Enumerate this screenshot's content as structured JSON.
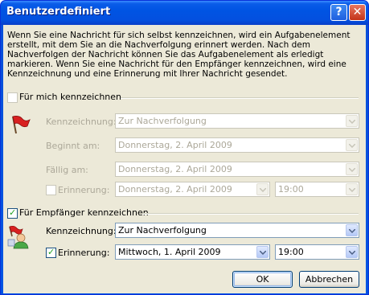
{
  "window": {
    "title": "Benutzerdefiniert",
    "help_glyph": "?",
    "close_glyph": "✕"
  },
  "intro_text": "Wenn Sie eine Nachricht für sich selbst kennzeichnen, wird ein Aufgabenelement erstellt, mit dem Sie an die Nachverfolgung erinnert werden. Nach dem Nachverfolgen der Nachricht können Sie das Aufgabenelement als erledigt markieren. Wenn Sie eine Nachricht für den Empfänger kennzeichnen, wird eine Kennzeichnung und eine Erinnerung mit Ihrer Nachricht gesendet.",
  "self_section": {
    "checkbox_label": "Für mich kennzeichnen",
    "checked": false,
    "flag_label": "Kennzeichnung:",
    "flag_value": "Zur Nachverfolgung",
    "start_label": "Beginnt am:",
    "start_value": "Donnerstag, 2. April 2009",
    "due_label": "Fällig am:",
    "due_value": "Donnerstag, 2. April 2009",
    "reminder_label": "Erinnerung:",
    "reminder_checked": false,
    "reminder_date": "Donnerstag, 2. April 2009",
    "reminder_time": "19:00"
  },
  "recipient_section": {
    "checkbox_label": "Für Empfänger kennzeichnen",
    "checked": true,
    "flag_label": "Kennzeichnung:",
    "flag_value": "Zur Nachverfolgung",
    "reminder_label": "Erinnerung:",
    "reminder_checked": true,
    "reminder_date": "Mittwoch, 1. April 2009",
    "reminder_time": "19:00"
  },
  "buttons": {
    "ok": "OK",
    "cancel": "Abbrechen"
  },
  "colors": {
    "titlebar": "#0054e3",
    "dialog_bg": "#ece9d8",
    "flag_red": "#d82020",
    "disabled_text": "#aca899"
  }
}
